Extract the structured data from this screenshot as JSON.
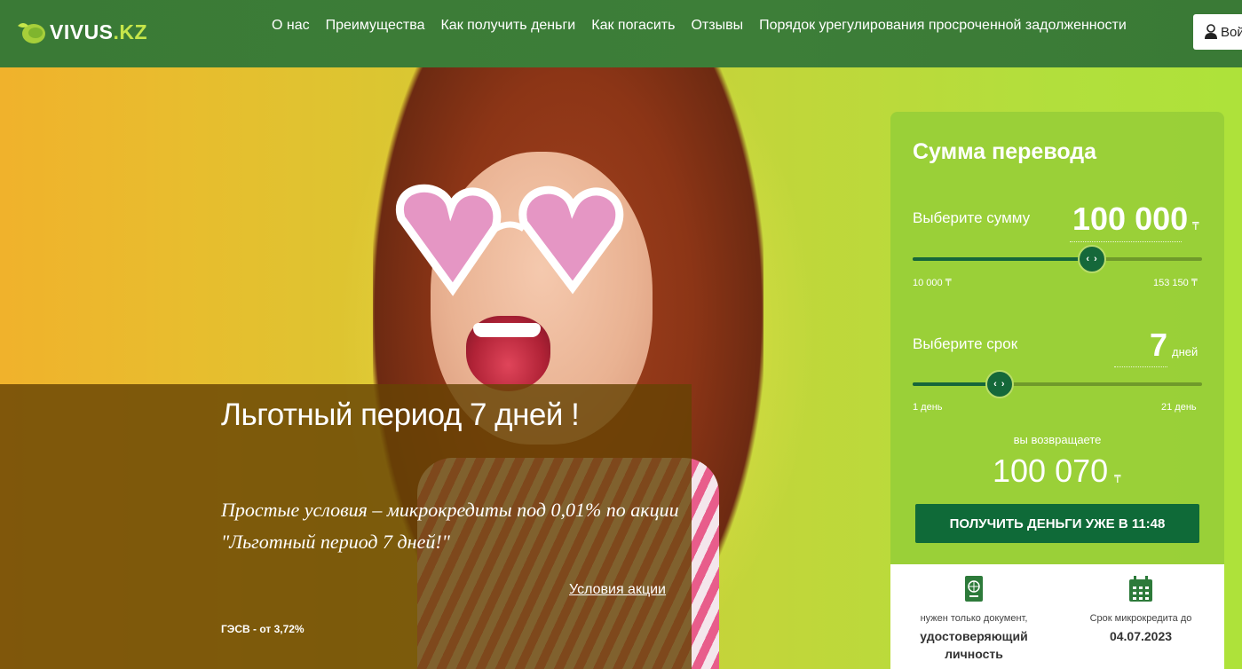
{
  "header": {
    "logo_main": "VIVUS",
    "logo_suffix": ".KZ",
    "nav": [
      "О нас",
      "Преимущества",
      "Как получить деньги",
      "Как погасить",
      "Отзывы",
      "Порядок урегулирования просроченной задолженности"
    ],
    "login_label": "Вой"
  },
  "promo": {
    "title": "Льготный период 7 дней !",
    "subtitle": "Простые условия – микрокредиты под 0,01% по акции \"Льготный период 7 дней!\"",
    "link": "Условия акции",
    "rate": "ГЭСВ - от 3,72%"
  },
  "calculator": {
    "title": "Сумма перевода",
    "amount_label": "Выберите сумму",
    "amount_value": "100 000",
    "currency": "₸",
    "amount_min": "10 000 ₸",
    "amount_max": "153 150 ₸",
    "amount_fraction": 0.62,
    "term_label": "Выберите срок",
    "term_value": "7",
    "term_unit": "дней",
    "term_min": "1 день",
    "term_max": "21 день",
    "term_fraction": 0.3,
    "return_label": "вы возвращаете",
    "return_value": "100 070",
    "cta": "ПОЛУЧИТЬ ДЕНЬГИ УЖЕ В 11:48",
    "info": [
      {
        "line1": "нужен только документ,",
        "line2": "удостоверяющий личность",
        "icon": "passport-icon"
      },
      {
        "line1": "Срок микрокредита до",
        "line2": "04.07.2023",
        "icon": "calendar-icon"
      }
    ]
  },
  "colors": {
    "header_green": "#3a7a36",
    "accent_green": "#0f6a38",
    "calc_green": "#98cf38"
  }
}
